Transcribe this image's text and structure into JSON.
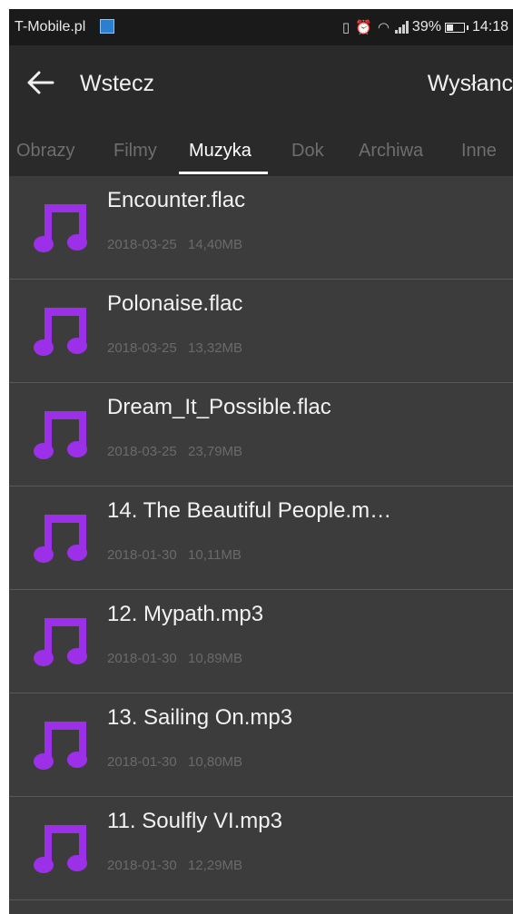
{
  "status_bar": {
    "carrier": "T-Mobile.pl",
    "battery_percent": "39%",
    "battery_level": 0.39,
    "time": "14:18",
    "icons": [
      "app-notification-icon",
      "vibrate-icon",
      "alarm-icon",
      "wifi-icon",
      "signal-icon",
      "battery-icon"
    ]
  },
  "toolbar": {
    "back_label": "Wstecz",
    "action_label": "Wysłanc"
  },
  "tabs": [
    {
      "label": "Obrazy",
      "active": false
    },
    {
      "label": "Filmy",
      "active": false
    },
    {
      "label": "Muzyka",
      "active": true
    },
    {
      "label": "Dok",
      "active": false
    },
    {
      "label": "Archiwa",
      "active": false
    },
    {
      "label": "Inne",
      "active": false
    }
  ],
  "files": [
    {
      "name": "Encounter.flac",
      "date": "2018-03-25",
      "size": "14,40MB",
      "icon": "music-note-icon"
    },
    {
      "name": "Polonaise.flac",
      "date": "2018-03-25",
      "size": "13,32MB",
      "icon": "music-note-icon"
    },
    {
      "name": "Dream_It_Possible.flac",
      "date": "2018-03-25",
      "size": "23,79MB",
      "icon": "music-note-icon"
    },
    {
      "name": "14. The Beautiful People.m…",
      "date": "2018-01-30",
      "size": "10,11MB",
      "icon": "music-note-icon"
    },
    {
      "name": "12. Mypath.mp3",
      "date": "2018-01-30",
      "size": "10,89MB",
      "icon": "music-note-icon"
    },
    {
      "name": "13. Sailing On.mp3",
      "date": "2018-01-30",
      "size": "10,80MB",
      "icon": "music-note-icon"
    },
    {
      "name": "11. Soulfly VI.mp3",
      "date": "2018-01-30",
      "size": "12,29MB",
      "icon": "music-note-icon"
    }
  ],
  "colors": {
    "accent_icon": "#9b30e8",
    "background": "#3c3c3c",
    "toolbar": "#2a2a2a",
    "status_bar": "#1a1a1a"
  }
}
